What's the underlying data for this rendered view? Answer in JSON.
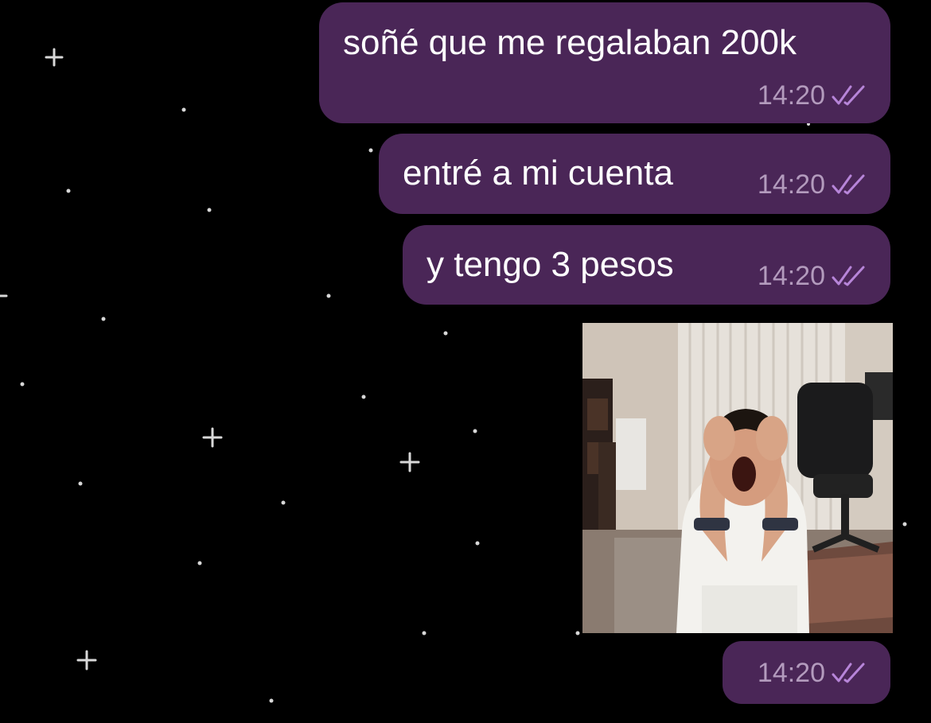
{
  "colors": {
    "background": "#000000",
    "bubble": "#4a2657",
    "text": "#ffffff",
    "time": "#b39bbd",
    "checks": "#b785d9"
  },
  "messages": [
    {
      "text": "soñé que me regalaban 200k",
      "time": "14:20",
      "status_icon": "double-check-icon"
    },
    {
      "text": "entré a mi cuenta",
      "time": "14:20",
      "status_icon": "double-check-icon"
    },
    {
      "text": "y tengo 3 pesos",
      "time": "14:20",
      "status_icon": "double-check-icon"
    }
  ],
  "media_message": {
    "image": "crying-meme-photo",
    "time": "14:20",
    "status_icon": "double-check-icon"
  }
}
